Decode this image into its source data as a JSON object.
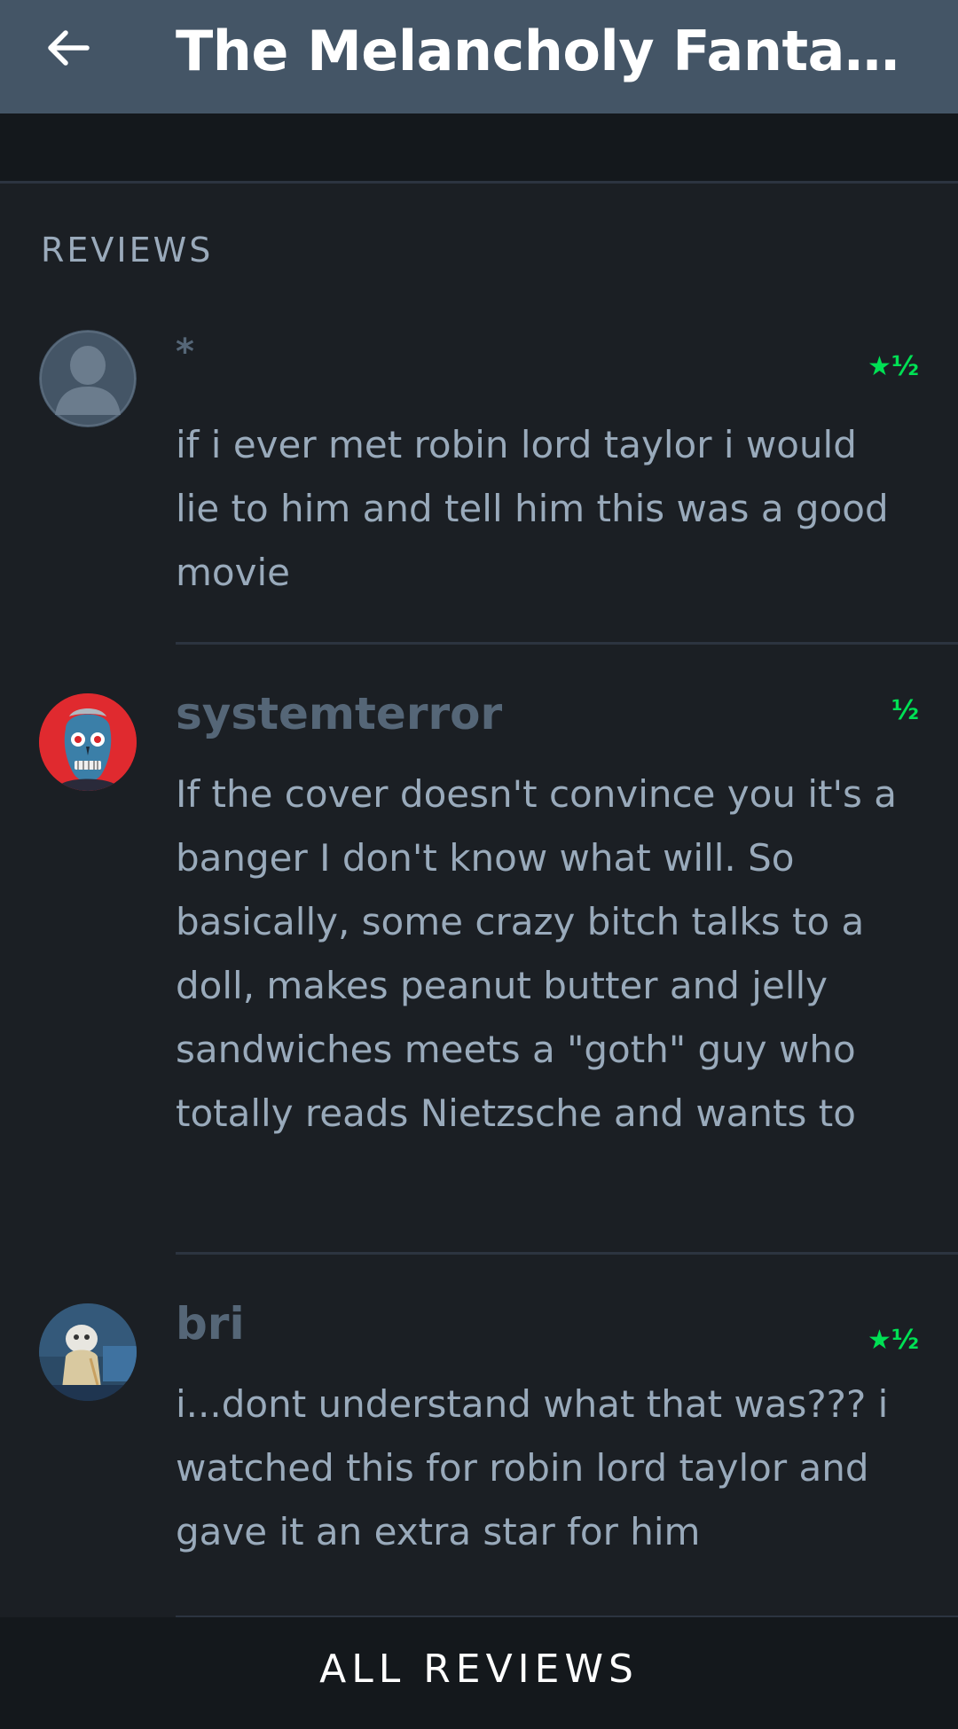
{
  "appbar": {
    "title": "The Melancholy Fantas...",
    "back_icon": "arrow-left-icon"
  },
  "section": {
    "label": "REVIEWS"
  },
  "reviews": [
    {
      "reviewer": "*",
      "rating": "★½",
      "text": "if i ever met robin lord taylor i would lie to him and tell him this was a good movie",
      "avatar": "default-person-avatar"
    },
    {
      "reviewer": "systemterror",
      "rating": "½",
      "text": "If the cover doesn't convince you it's a banger I don't know what will. So basically, some crazy bitch talks to a doll, makes peanut butter and jelly sandwiches meets a \"goth\" guy who totally reads Nietzsche and wants to bone: the movie. File this one under ...",
      "avatar": "skull-face-avatar"
    },
    {
      "reviewer": "bri",
      "rating": "★½",
      "text": "i...dont understand what that was??? i watched this for robin lord taylor and gave it an extra star for him",
      "avatar": "photo-avatar"
    }
  ],
  "footer": {
    "all_reviews": "ALL REVIEWS"
  },
  "colors": {
    "appbar": "#445566",
    "background": "#1b1f24",
    "rating_green": "#00e054",
    "text": "#99aabb",
    "reviewer_name": "#556677"
  }
}
